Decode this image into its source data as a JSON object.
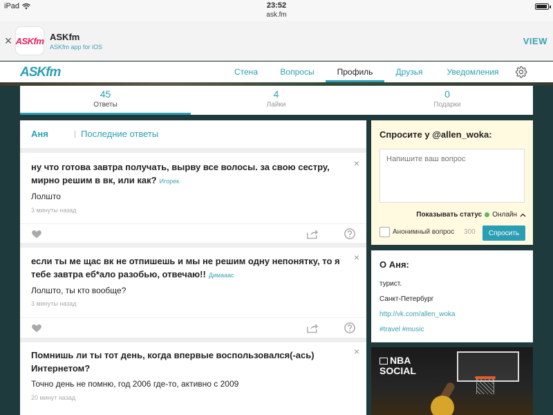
{
  "status_bar": {
    "device": "iPad",
    "time": "23:52",
    "url": "ask.fm"
  },
  "app_banner": {
    "icon_text": "ASKfm",
    "title": "ASKfm",
    "subtitle": "ASKfm app for iOS",
    "view_label": "VIEW"
  },
  "nav": {
    "logo": "ASKfm",
    "tabs": [
      {
        "label": "Стена"
      },
      {
        "label": "Вопросы"
      },
      {
        "label": "Профиль"
      },
      {
        "label": "Друзья"
      },
      {
        "label": "Уведомления"
      }
    ],
    "active_tab": "Профиль"
  },
  "stats": [
    {
      "number": "45",
      "label": "Ответы"
    },
    {
      "number": "4",
      "label": "Лайки"
    },
    {
      "number": "0",
      "label": "Подарки"
    }
  ],
  "feed": {
    "user_name": "Аня",
    "separator": "|",
    "recent_label": "Последние ответы",
    "items": [
      {
        "question": "ну что готова завтра получать, вырву все волосы. за свою сестру, мирно решим в вк, или как?",
        "author": "Игорек",
        "answer": "Лолшто",
        "time": "3 минуты назад"
      },
      {
        "question": "если ты ме щас вк не отпишешь и мы не решим одну непонятку, то я тебе завтра еб*ало разобью, отвечаю!!",
        "author": "Димааас",
        "answer": "Лолшто, ты кто вообще?",
        "time": "3 минуты назад"
      },
      {
        "question": "Помнишь ли ты тот день, когда впервые воспользовался(-ась) Интернетом?",
        "author": "",
        "answer": "Точно день не помню, год 2006 где-то, активно с 2009",
        "time": "20 минут назад"
      }
    ]
  },
  "ask": {
    "title": "Спросите у @allen_woka:",
    "placeholder": "Напишите ваш вопрос",
    "show_status_label": "Показывать статус",
    "online_label": "Онлайн",
    "anon_label": "Анонимный вопрос",
    "char_count": "300",
    "submit_label": "Спросить"
  },
  "about": {
    "title": "О Аня:",
    "bio": "турист.",
    "city": "Санкт-Петербург",
    "link": "http://vk.com/allen_woka",
    "tags": "#travel #music"
  },
  "ad": {
    "line1": "NBA",
    "line2": "SOCIAL"
  },
  "colors": {
    "accent": "#2a9fb4",
    "background": "#1f3a3c",
    "ask_box": "#fffae0",
    "online": "#5cb85c",
    "brand_pink": "#ee1c5c"
  }
}
